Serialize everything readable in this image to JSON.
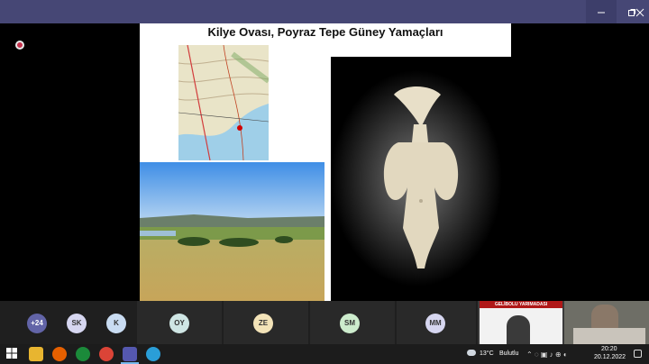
{
  "slide": {
    "title": "Kilye Ovası, Poyraz Tepe Güney Yamaçları"
  },
  "participants": [
    {
      "initials": "+24",
      "color": "#6264a7",
      "text_color": "#ffffff"
    },
    {
      "initials": "SK",
      "color": "#d6d6f0",
      "text_color": "#333333"
    },
    {
      "initials": "K",
      "color": "#c9dcf2",
      "text_color": "#333333"
    },
    {
      "initials": "OY",
      "color": "#cfe6e4",
      "text_color": "#333333"
    },
    {
      "initials": "ZE",
      "color": "#f3e3b8",
      "text_color": "#333333"
    },
    {
      "initials": "SM",
      "color": "#cdeccd",
      "text_color": "#333333"
    },
    {
      "initials": "MM",
      "color": "#d6d6f0",
      "text_color": "#333333"
    }
  ],
  "video_tile": {
    "banner_title": "GELİBOLU YARIMADASI"
  },
  "tray": {
    "temperature": "13°C",
    "weather": "Bulutlu",
    "time": "20:20",
    "date": "20.12.2022"
  },
  "colors": {
    "titlebar": "#464775",
    "accent": "#6264a7"
  }
}
